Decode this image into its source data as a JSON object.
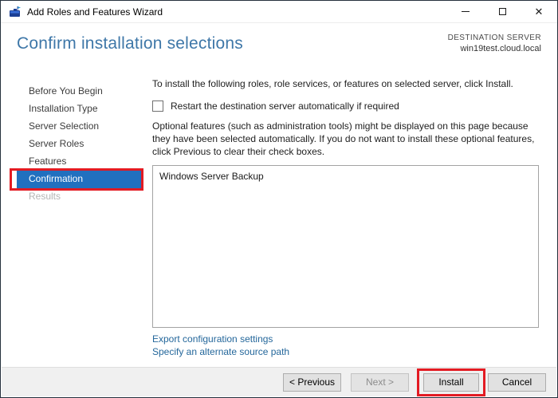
{
  "window": {
    "title": "Add Roles and Features Wizard",
    "icons": {
      "app": "server-manager-icon",
      "minimize": "minimize-icon",
      "maximize": "maximize-icon",
      "close": "close-icon"
    },
    "close_glyph": "✕"
  },
  "header": {
    "title": "Confirm installation selections",
    "destination_label": "DESTINATION SERVER",
    "destination_server": "win19test.cloud.local"
  },
  "sidebar": {
    "items": [
      {
        "label": "Before You Begin",
        "state": "enabled"
      },
      {
        "label": "Installation Type",
        "state": "enabled"
      },
      {
        "label": "Server Selection",
        "state": "enabled"
      },
      {
        "label": "Server Roles",
        "state": "enabled"
      },
      {
        "label": "Features",
        "state": "enabled"
      },
      {
        "label": "Confirmation",
        "state": "selected",
        "annotated": true
      },
      {
        "label": "Results",
        "state": "disabled"
      }
    ]
  },
  "main": {
    "intro": "To install the following roles, role services, or features on selected server, click Install.",
    "restart_checkbox": {
      "label": "Restart the destination server automatically if required",
      "checked": false
    },
    "optional_note": "Optional features (such as administration tools) might be displayed on this page because they have been selected automatically. If you do not want to install these optional features, click Previous to clear their check boxes.",
    "selection_list": [
      "Windows Server Backup"
    ],
    "links": [
      "Export configuration settings",
      "Specify an alternate source path"
    ]
  },
  "footer": {
    "buttons": [
      {
        "label": "< Previous",
        "state": "enabled"
      },
      {
        "label": "Next >",
        "state": "disabled"
      },
      {
        "label": "Install",
        "state": "enabled",
        "annotated": true
      },
      {
        "label": "Cancel",
        "state": "enabled"
      }
    ]
  },
  "colors": {
    "selected_item_blue": "#2170bf",
    "annotation_red": "#e31b23",
    "header_title_blue": "#3e77a8",
    "link_blue": "#24679b",
    "window_border": "#25313d",
    "footer_gray": "#f0f0f0",
    "button_gray": "#e1e1e1"
  }
}
